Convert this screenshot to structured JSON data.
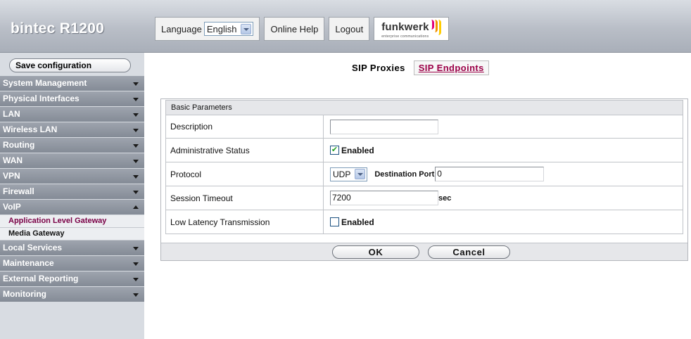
{
  "header": {
    "brand": "bintec R1200",
    "language_label": "Language",
    "language_value": "English",
    "online_help": "Online Help",
    "logout": "Logout",
    "logo_text": "funkwerk",
    "logo_sub": "enterprise communications"
  },
  "sidebar": {
    "save_label": "Save configuration",
    "items": {
      "system_management": "System Management",
      "physical_interfaces": "Physical Interfaces",
      "lan": "LAN",
      "wireless_lan": "Wireless LAN",
      "routing": "Routing",
      "wan": "WAN",
      "vpn": "VPN",
      "firewall": "Firewall",
      "voip": "VoIP",
      "alg": "Application Level Gateway",
      "media_gateway": "Media Gateway",
      "local_services": "Local Services",
      "maintenance": "Maintenance",
      "external_reporting": "External Reporting",
      "monitoring": "Monitoring"
    }
  },
  "tabs": {
    "active": "SIP Proxies",
    "other": "SIP Endpoints"
  },
  "form": {
    "section_title": "Basic Parameters",
    "description_label": "Description",
    "description_value": "",
    "admin_status_label": "Administrative Status",
    "admin_status_checkbox": "Enabled",
    "admin_status_checked": true,
    "protocol_label": "Protocol",
    "protocol_value": "UDP",
    "dest_port_label": "Destination Port",
    "dest_port_value": "0",
    "session_timeout_label": "Session Timeout",
    "session_timeout_value": "7200",
    "session_timeout_unit": "sec",
    "low_latency_label": "Low Latency Transmission",
    "low_latency_checkbox": "Enabled",
    "low_latency_checked": false,
    "ok_label": "OK",
    "cancel_label": "Cancel"
  },
  "colors": {
    "accent_link": "#9b0047",
    "nav_bg": "#8f96a0",
    "header_bg": "#b9bec7"
  }
}
